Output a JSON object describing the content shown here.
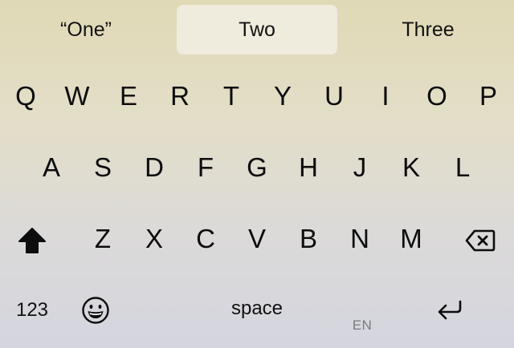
{
  "suggestions": [
    "“One”",
    "Two",
    "Three"
  ],
  "rows": {
    "row1": [
      "Q",
      "W",
      "E",
      "R",
      "T",
      "Y",
      "U",
      "I",
      "O",
      "P"
    ],
    "row2": [
      "A",
      "S",
      "D",
      "F",
      "G",
      "H",
      "J",
      "K",
      "L"
    ],
    "row3": [
      "Z",
      "X",
      "C",
      "V",
      "B",
      "N",
      "M"
    ]
  },
  "bottom": {
    "numbers_label": "123",
    "space_label": "space",
    "language_label": "EN"
  },
  "icons": {
    "shift": "shift-icon",
    "delete": "delete-icon",
    "emoji": "emoji-icon",
    "return": "return-icon"
  },
  "colors": {
    "background_top": "#e0d9b6",
    "background_bottom": "#d4d5df",
    "selected_suggestion": "#efebdd",
    "key_text": "#0d0d0d",
    "secondary_text": "#7a7a80"
  }
}
